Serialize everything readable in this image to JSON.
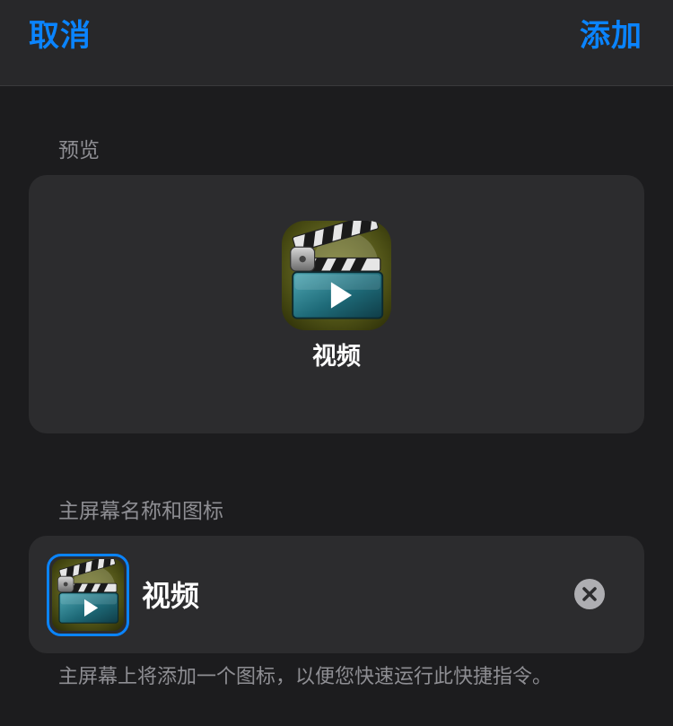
{
  "nav": {
    "cancel_label": "取消",
    "add_label": "添加"
  },
  "preview": {
    "section_label": "预览",
    "app_name": "视频",
    "icon": "clapperboard-play-icon"
  },
  "home_screen": {
    "section_label": "主屏幕名称和图标",
    "name_value": "视频",
    "icon": "clapperboard-play-icon",
    "clear_icon": "clear-x-icon",
    "footnote": "主屏幕上将添加一个图标，以便您快速运行此快捷指令。"
  },
  "colors": {
    "accent": "#0a84ff",
    "background": "#1c1c1e",
    "card": "#2c2c2e",
    "secondary_text": "#8e8e93"
  }
}
